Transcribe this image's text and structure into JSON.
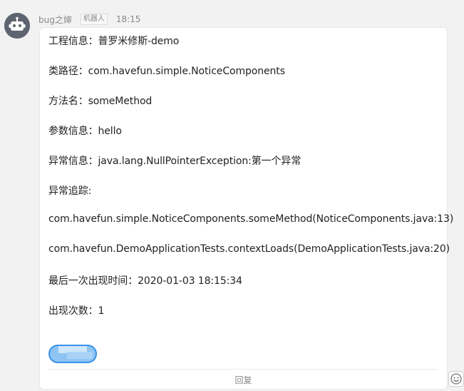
{
  "sender": {
    "name": "bug之婶",
    "badge": "机器人",
    "time": "18:15"
  },
  "message": {
    "lines": [
      "工程信息：普罗米修斯-demo",
      "类路径：com.havefun.simple.NoticeComponents",
      "方法名：someMethod",
      "参数信息：hello",
      "异常信息：java.lang.NullPointerException:第一个异常",
      "异常追踪:",
      "com.havefun.simple.NoticeComponents.someMethod(NoticeComponents.java:13)",
      "com.havefun.DemoApplicationTests.contextLoads(DemoApplicationTests.java:20)",
      "最后一次出现时间：2020-01-03 18:15:34",
      "出现次数：1"
    ],
    "reply_label": "回复"
  },
  "icons": {
    "avatar": "robot-avatar-icon",
    "emoji": "smiley-icon"
  },
  "colors": {
    "button_border": "#3b92e8",
    "button_fill": "#8dc4f3"
  }
}
